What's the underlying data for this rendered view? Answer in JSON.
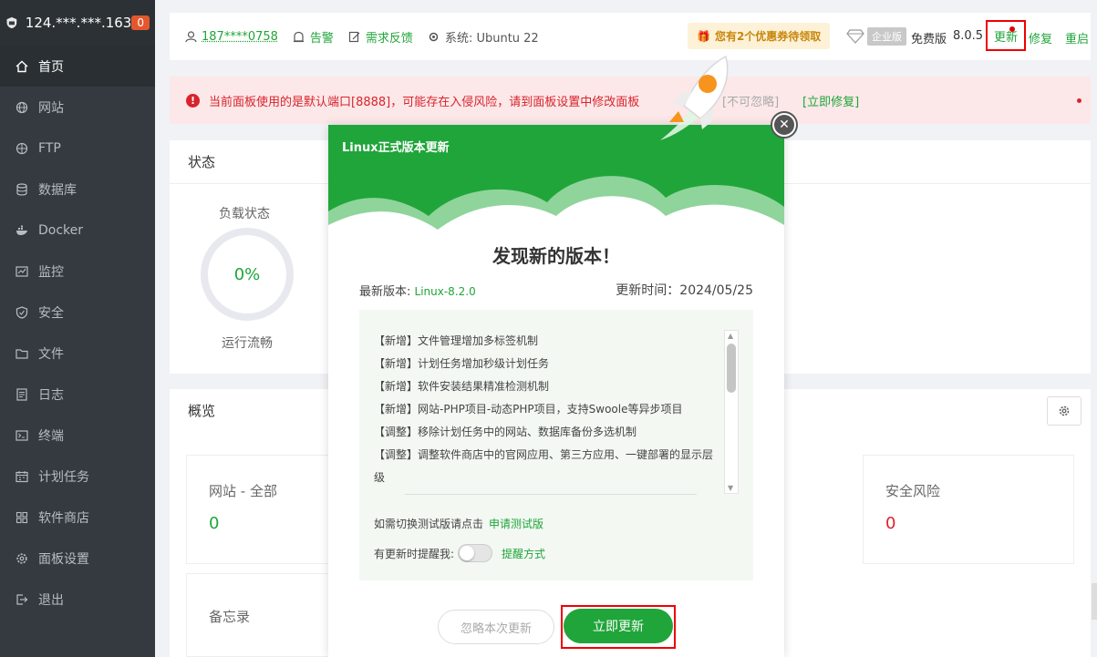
{
  "sidebar": {
    "server_ip": "124.***.***.163",
    "badge": "0",
    "items": [
      {
        "label": "首页",
        "icon": "home-icon"
      },
      {
        "label": "网站",
        "icon": "globe-icon"
      },
      {
        "label": "FTP",
        "icon": "ftp-icon"
      },
      {
        "label": "数据库",
        "icon": "database-icon"
      },
      {
        "label": "Docker",
        "icon": "docker-icon"
      },
      {
        "label": "监控",
        "icon": "monitor-icon"
      },
      {
        "label": "安全",
        "icon": "shield-icon"
      },
      {
        "label": "文件",
        "icon": "folder-icon"
      },
      {
        "label": "日志",
        "icon": "log-icon"
      },
      {
        "label": "终端",
        "icon": "terminal-icon"
      },
      {
        "label": "计划任务",
        "icon": "calendar-icon"
      },
      {
        "label": "软件商店",
        "icon": "apps-icon"
      },
      {
        "label": "面板设置",
        "icon": "gear-icon"
      },
      {
        "label": "退出",
        "icon": "logout-icon"
      }
    ]
  },
  "topbar": {
    "user": "187****0758",
    "alarm": "告警",
    "feedback": "需求反馈",
    "system": "系统: Ubuntu 22",
    "coupon": "您有2个优惠券待领取",
    "enterprise_tag": "企业版",
    "free_edition": "免费版",
    "version": "8.0.5",
    "update": "更新",
    "repair": "修复",
    "restart": "重启"
  },
  "alert": {
    "message": "当前面板使用的是默认端口[8888]，可能存在入侵风险，请到面板设置中修改面板",
    "cant_ignore": "[不可忽略]",
    "fix_now": "[立即修复]"
  },
  "status": {
    "title": "状态",
    "load_label": "负载状态",
    "load_value": "0%",
    "load_status": "运行流畅"
  },
  "overview": {
    "title": "概览",
    "website_label": "网站 - 全部",
    "website_count": "0",
    "risk_label": "安全风险",
    "risk_count": "0",
    "memo_label": "备忘录"
  },
  "modal": {
    "header_title": "Linux正式版本更新",
    "found_title": "发现新的版本！",
    "latest_label": "最新版本: ",
    "latest_version": "Linux-8.2.0",
    "update_time": "更新时间：2024/05/25",
    "changelog": [
      "【新增】文件管理增加多标签机制",
      "【新增】计划任务增加秒级计划任务",
      "【新增】软件安装结果精准检测机制",
      "【新增】网站-PHP项目-动态PHP项目，支持Swoole等异步项目",
      "【调整】移除计划任务中的网站、数据库备份多选机制",
      "【调整】调整软件商店中的官网应用、第三方应用、一键部署的显示层",
      "级"
    ],
    "trial_text": "如需切换测试版请点击",
    "trial_link": "申请测试版",
    "remind_text": "有更新时提醒我:",
    "remind_link": "提醒方式",
    "ignore_button": "忽略本次更新",
    "update_button": "立即更新"
  },
  "colors": {
    "brand_green": "#20a53a",
    "sidebar_bg": "#343a40",
    "danger_red": "#d9232d",
    "highlight_border": "#ee0000"
  }
}
